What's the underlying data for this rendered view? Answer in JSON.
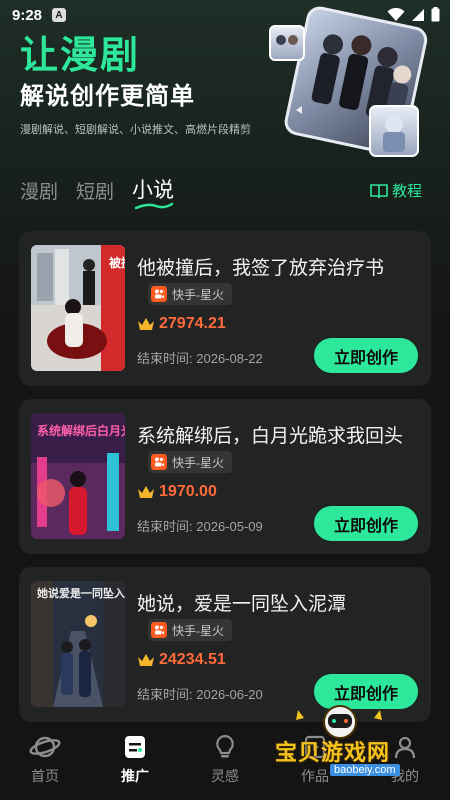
{
  "status_bar": {
    "time": "9:28",
    "notification_glyph": "A"
  },
  "hero": {
    "title": "让漫剧",
    "subtitle": "解说创作更简单",
    "description": "漫剧解说、短剧解说、小说推文、高燃片段精剪"
  },
  "tabs": [
    {
      "label": "漫剧",
      "active": false
    },
    {
      "label": "短剧",
      "active": false
    },
    {
      "label": "小说",
      "active": true
    }
  ],
  "tutorial_label": "教程",
  "cards": [
    {
      "title": "他被撞后，我签了放弃治疗书",
      "source": "快手-星火",
      "heat": "27974.21",
      "end_time_label": "结束时间:",
      "end_time": "2026-08-22",
      "button": "立即创作",
      "cover_text": "被撞后"
    },
    {
      "title": "系统解绑后，白月光跪求我回头",
      "source": "快手-星火",
      "heat": "1970.00",
      "end_time_label": "结束时间:",
      "end_time": "2026-05-09",
      "button": "立即创作",
      "cover_text": "系统解绑后白月光跪求我回头"
    },
    {
      "title": "她说，爱是一同坠入泥潭",
      "source": "快手-星火",
      "heat": "24234.51",
      "end_time_label": "结束时间:",
      "end_time": "2026-06-20",
      "button": "立即创作",
      "cover_text": "她说爱是一同坠入泥潭"
    }
  ],
  "bottom_nav": [
    {
      "label": "首页",
      "icon": "planet-icon",
      "active": false
    },
    {
      "label": "推广",
      "icon": "promote-icon",
      "active": true
    },
    {
      "label": "灵感",
      "icon": "bulb-icon",
      "active": false
    },
    {
      "label": "作品",
      "icon": "works-icon",
      "active": false
    },
    {
      "label": "我的",
      "icon": "profile-icon",
      "active": false
    }
  ],
  "watermark": {
    "text": "宝贝游戏网",
    "url": "baobeiy.com"
  },
  "colors": {
    "accent": "#2de89a",
    "heat": "#ff6a3a",
    "card_bg": "#222323",
    "background": "#141414"
  }
}
